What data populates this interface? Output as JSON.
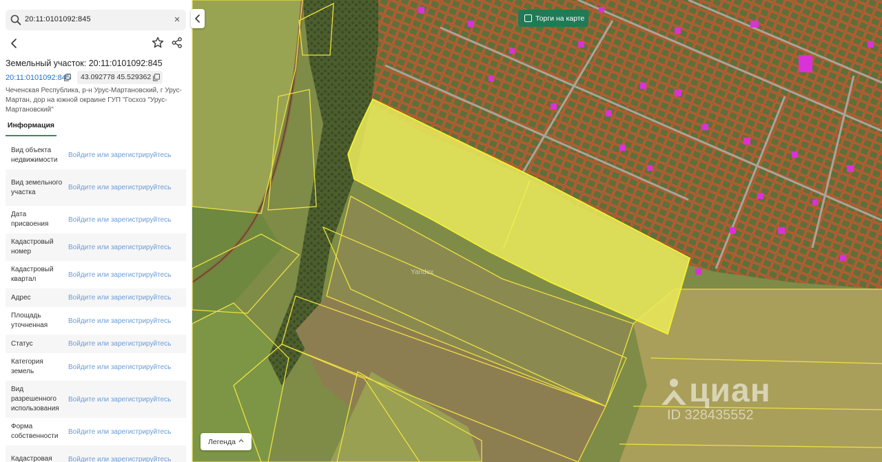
{
  "search": {
    "value": "20:11:0101092:845",
    "clear_symbol": "×"
  },
  "parcel": {
    "title": "Земельный участок: 20:11:0101092:845",
    "cadastral_number": "20:11:0101092:845",
    "coordinates": "43.092778 45.529362",
    "address": "Чеченская Республика, р-н Урус-Мартановский, г Урус-Мартан, дор на южной окраине ГУП \"Госхоз \"Урус-Мартановский\""
  },
  "tabs": {
    "info": "Информация"
  },
  "info_rows": [
    {
      "label": "Вид объекта недвижимости",
      "value": "Войдите или зарегистрируйтесь"
    },
    {
      "label": "Вид земельного участка",
      "value": "Войдите или зарегистрируйтесь"
    },
    {
      "label": "Дата присвоения",
      "value": "Войдите или зарегистрируйтесь"
    },
    {
      "label": "Кадастровый номер",
      "value": "Войдите или зарегистрируйтесь"
    },
    {
      "label": "Кадастровый квартал",
      "value": "Войдите или зарегистрируйтесь"
    },
    {
      "label": "Адрес",
      "value": "Войдите или зарегистрируйтесь"
    },
    {
      "label": "Площадь уточненная",
      "value": "Войдите или зарегистрируйтесь"
    },
    {
      "label": "Статус",
      "value": "Войдите или зарегистрируйтесь"
    },
    {
      "label": "Категория земель",
      "value": "Войдите или зарегистрируйтесь"
    },
    {
      "label": "Вид разрешенного использования",
      "value": "Войдите или зарегистрируйтесь"
    },
    {
      "label": "Форма собственности",
      "value": "Войдите или зарегистрируйтесь"
    },
    {
      "label": "Кадастровая",
      "value": "Войдите или зарегистрируйтесь"
    }
  ],
  "map": {
    "torgi_label": "Торги на карте",
    "legend_label": "Легенда",
    "yandex_watermark": "Yandex",
    "cian_brand": "циан",
    "cian_id": "ID 328435552",
    "colors": {
      "selected_fill": "#e8e85a",
      "parcel_outline": "#f0e040",
      "residential_outline": "#e8502a",
      "building_marker": "#d832d8",
      "accent_green": "#1f7a56",
      "link_blue": "#1a6fd4"
    }
  },
  "icons": {
    "search": "search-icon",
    "clear": "close-icon",
    "back": "chevron-left-icon",
    "favorite": "star-icon",
    "share": "share-icon",
    "copy": "copy-icon",
    "collapse": "chevron-left-icon",
    "legend": "chevron-up-icon"
  }
}
